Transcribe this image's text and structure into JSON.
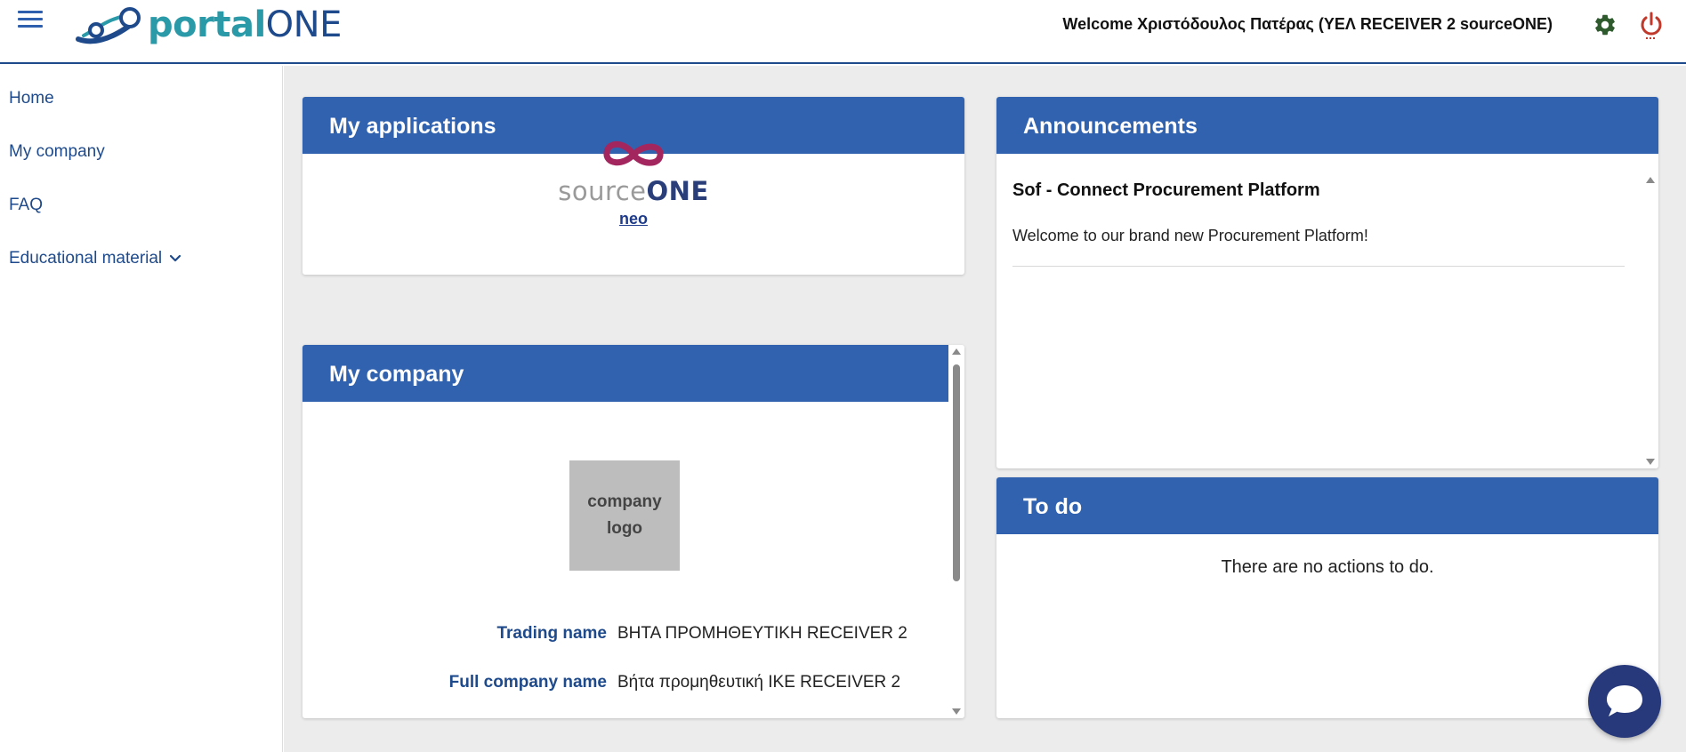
{
  "header": {
    "brand_part1": "portal",
    "brand_part2": "ONE",
    "welcome": "Welcome Χριστόδουλος Πατέρας (ΥΕΛ RECEIVER 2 sourceONE)",
    "accent_color": "#3062b0",
    "icons": {
      "menu": "hamburger-icon",
      "settings": "gear-icon",
      "logout": "power-icon"
    }
  },
  "sidebar": {
    "items": [
      {
        "label": "Home"
      },
      {
        "label": "My company"
      },
      {
        "label": "FAQ"
      },
      {
        "label": "Educational material",
        "expandable": true
      }
    ]
  },
  "applications": {
    "title": "My applications",
    "app": {
      "brand_part1": "source",
      "brand_part2": "ONE",
      "link": "neo"
    }
  },
  "company": {
    "title": "My company",
    "logo_placeholder_line1": "company",
    "logo_placeholder_line2": "logo",
    "fields": [
      {
        "label": "Trading name",
        "value": "ΒΗΤΑ ΠΡΟΜΗΘΕΥΤΙΚΗ RECEIVER 2"
      },
      {
        "label": "Full company name",
        "value": "Βήτα προμηθευτική ΙΚΕ RECEIVER 2"
      }
    ]
  },
  "announcements": {
    "title": "Announcements",
    "items": [
      {
        "title": "Sof - Connect Procurement Platform",
        "body": "Welcome to our brand new Procurement Platform!"
      }
    ]
  },
  "todo": {
    "title": "To do",
    "empty_text": "There are no actions to do."
  },
  "chat": {
    "icon": "chat-bubble-icon"
  }
}
